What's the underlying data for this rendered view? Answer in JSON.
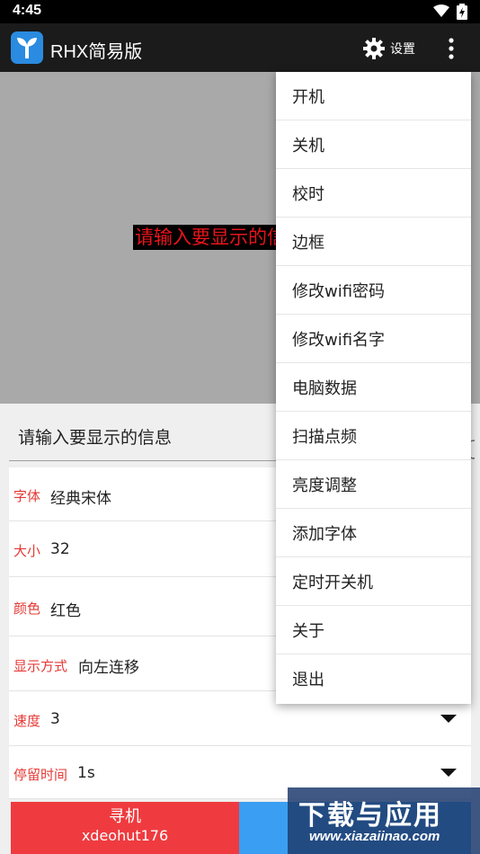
{
  "status_bar": {
    "time": "4:45"
  },
  "app_bar": {
    "title": "RHX简易版",
    "settings_label": "设置"
  },
  "preview": {
    "text": "请输入要显示的信息"
  },
  "form": {
    "message_placeholder": "请输入要显示的信息",
    "rows": [
      {
        "label": "字体",
        "value": "经典宋体"
      },
      {
        "label": "大小",
        "value": "32"
      },
      {
        "label": "颜色",
        "value": "红色"
      },
      {
        "label": "显示方式",
        "value": "向左连移"
      },
      {
        "label": "速度",
        "value": "3"
      },
      {
        "label": "停留时间",
        "value": "1s"
      }
    ]
  },
  "buttons": {
    "find_title": "寻机",
    "find_device": "xdeohut176"
  },
  "menu": {
    "items": [
      "开机",
      "关机",
      "校时",
      "边框",
      "修改wifi密码",
      "修改wifi名字",
      "电脑数据",
      "扫描点频",
      "亮度调整",
      "添加字体",
      "定时开关机",
      "关于",
      "退出"
    ]
  },
  "watermark": {
    "line1": "下载与应用",
    "line2": "www.xiazaiinao.com"
  },
  "colors": {
    "accent_red": "#e53935",
    "find_button": "#ef3b3f",
    "blue_button": "#3a9ff2",
    "preview_bg": "#a9a9a9",
    "preview_text": "#e8141c"
  }
}
